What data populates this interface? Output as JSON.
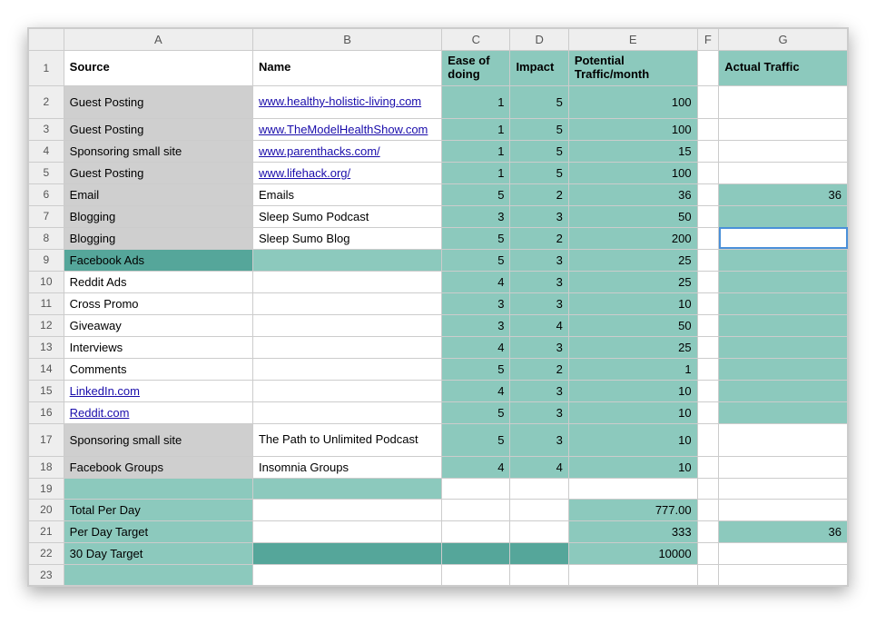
{
  "columns": [
    "A",
    "B",
    "C",
    "D",
    "E",
    "F",
    "G"
  ],
  "headers": {
    "A": "Source",
    "B": "Name",
    "C": "Ease of doing",
    "D": "Impact",
    "E": "Potential Traffic/month",
    "F": "",
    "G": "Actual Traffic"
  },
  "rows": [
    {
      "n": 2,
      "A": "Guest Posting",
      "B": "www.healthy-holistic-living.com",
      "B_link": true,
      "C": "1",
      "D": "5",
      "E": "100",
      "G": "",
      "A_fill": "grey",
      "B_wrap": true
    },
    {
      "n": 3,
      "A": "Guest Posting",
      "B": "www.TheModelHealthShow.com",
      "B_link": true,
      "C": "1",
      "D": "5",
      "E": "100",
      "G": "",
      "A_fill": "grey"
    },
    {
      "n": 4,
      "A": "Sponsoring small site",
      "B": "www.parenthacks.com/",
      "B_link": true,
      "C": "1",
      "D": "5",
      "E": "15",
      "G": "",
      "A_fill": "grey"
    },
    {
      "n": 5,
      "A": "Guest Posting",
      "B": "www.lifehack.org/",
      "B_link": true,
      "C": "1",
      "D": "5",
      "E": "100",
      "G": "",
      "A_fill": "grey"
    },
    {
      "n": 6,
      "A": "Email",
      "B": "Emails",
      "C": "5",
      "D": "2",
      "E": "36",
      "G": "36",
      "A_fill": "grey",
      "G_fill": "teal"
    },
    {
      "n": 7,
      "A": "Blogging",
      "B": "Sleep Sumo Podcast",
      "C": "3",
      "D": "3",
      "E": "50",
      "G": "",
      "A_fill": "grey",
      "G_fill": "teal"
    },
    {
      "n": 8,
      "A": "Blogging",
      "B": "Sleep Sumo Blog",
      "C": "5",
      "D": "2",
      "E": "200",
      "G": "",
      "A_fill": "grey",
      "G_active": true
    },
    {
      "n": 9,
      "A": "Facebook Ads",
      "B": "",
      "C": "5",
      "D": "3",
      "E": "25",
      "G": "",
      "A_fill": "teal-dark",
      "B_fill": "teal",
      "G_fill": "teal"
    },
    {
      "n": 10,
      "A": "Reddit Ads",
      "B": "",
      "C": "4",
      "D": "3",
      "E": "25",
      "G": "",
      "G_fill": "teal"
    },
    {
      "n": 11,
      "A": "Cross Promo",
      "B": "",
      "C": "3",
      "D": "3",
      "E": "10",
      "G": "",
      "G_fill": "teal"
    },
    {
      "n": 12,
      "A": "Giveaway",
      "B": "",
      "C": "3",
      "D": "4",
      "E": "50",
      "G": "",
      "G_fill": "teal"
    },
    {
      "n": 13,
      "A": "Interviews",
      "B": "",
      "C": "4",
      "D": "3",
      "E": "25",
      "G": "",
      "G_fill": "teal"
    },
    {
      "n": 14,
      "A": "Comments",
      "B": "",
      "C": "5",
      "D": "2",
      "E": "1",
      "G": "",
      "G_fill": "teal"
    },
    {
      "n": 15,
      "A": "LinkedIn.com",
      "A_link": true,
      "B": "",
      "C": "4",
      "D": "3",
      "E": "10",
      "G": "",
      "G_fill": "teal"
    },
    {
      "n": 16,
      "A": "Reddit.com",
      "A_link": true,
      "B": "",
      "C": "5",
      "D": "3",
      "E": "10",
      "G": "",
      "G_fill": "teal"
    },
    {
      "n": 17,
      "A": "Sponsoring small site",
      "B": "The Path to Unlimited Podcast",
      "C": "5",
      "D": "3",
      "E": "10",
      "G": "",
      "A_fill": "grey",
      "B_wrap": true
    },
    {
      "n": 18,
      "A": "Facebook Groups",
      "B": "Insomnia Groups",
      "C": "4",
      "D": "4",
      "E": "10",
      "G": "",
      "A_fill": "grey"
    },
    {
      "n": 19,
      "A": "",
      "B": "",
      "C": "",
      "D": "",
      "E": "",
      "G": "",
      "A_fill": "teal",
      "B_fill": "teal"
    },
    {
      "n": 20,
      "A": "Total Per Day",
      "B": "",
      "C": "",
      "D": "",
      "E": "777.00",
      "G": "",
      "A_fill": "teal",
      "E_fill": "teal"
    },
    {
      "n": 21,
      "A": "Per Day Target",
      "B": "",
      "C": "",
      "D": "",
      "E": "333",
      "G": "36",
      "A_fill": "teal",
      "E_fill": "teal",
      "G_fill": "teal"
    },
    {
      "n": 22,
      "A": "30 Day Target",
      "B": "",
      "C": "",
      "D": "",
      "E": "10000",
      "G": "",
      "A_fill": "teal",
      "B_fill": "teal-dark",
      "C_fill": "teal-dark",
      "D_fill": "teal-dark",
      "E_fill": "teal"
    },
    {
      "n": 23,
      "A": "",
      "B": "",
      "C": "",
      "D": "",
      "E": "",
      "G": "",
      "A_fill": "teal"
    }
  ],
  "chart_data": {
    "type": "table",
    "title": "",
    "columns": [
      "Source",
      "Name",
      "Ease of doing",
      "Impact",
      "Potential Traffic/month",
      "Actual Traffic"
    ],
    "rows": [
      [
        "Guest Posting",
        "www.healthy-holistic-living.com",
        1,
        5,
        100,
        null
      ],
      [
        "Guest Posting",
        "www.TheModelHealthShow.com",
        1,
        5,
        100,
        null
      ],
      [
        "Sponsoring small site",
        "www.parenthacks.com/",
        1,
        5,
        15,
        null
      ],
      [
        "Guest Posting",
        "www.lifehack.org/",
        1,
        5,
        100,
        null
      ],
      [
        "Email",
        "Emails",
        5,
        2,
        36,
        36
      ],
      [
        "Blogging",
        "Sleep Sumo Podcast",
        3,
        3,
        50,
        null
      ],
      [
        "Blogging",
        "Sleep Sumo Blog",
        5,
        2,
        200,
        null
      ],
      [
        "Facebook Ads",
        "",
        5,
        3,
        25,
        null
      ],
      [
        "Reddit Ads",
        "",
        4,
        3,
        25,
        null
      ],
      [
        "Cross Promo",
        "",
        3,
        3,
        10,
        null
      ],
      [
        "Giveaway",
        "",
        3,
        4,
        50,
        null
      ],
      [
        "Interviews",
        "",
        4,
        3,
        25,
        null
      ],
      [
        "Comments",
        "",
        5,
        2,
        1,
        null
      ],
      [
        "LinkedIn.com",
        "",
        4,
        3,
        10,
        null
      ],
      [
        "Reddit.com",
        "",
        5,
        3,
        10,
        null
      ],
      [
        "Sponsoring small site",
        "The Path to Unlimited Podcast",
        5,
        3,
        10,
        null
      ],
      [
        "Facebook Groups",
        "Insomnia Groups",
        4,
        4,
        10,
        null
      ]
    ],
    "summary": {
      "Total Per Day": 777.0,
      "Per Day Target": 333,
      "30 Day Target": 10000,
      "Actual Traffic Sum": 36
    }
  }
}
